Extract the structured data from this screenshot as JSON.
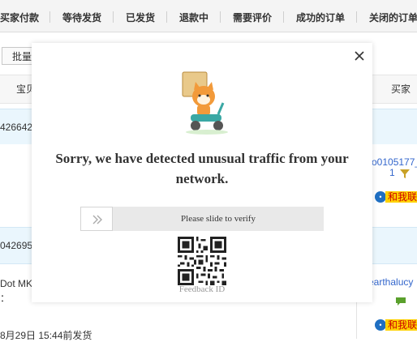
{
  "tabs": [
    "买家付款",
    "等待发货",
    "已发货",
    "退款中",
    "需要评价",
    "成功的订单",
    "关闭的订单"
  ],
  "toolbar": {
    "batch_label": "批量"
  },
  "table_header": {
    "product_label": "宝贝",
    "buyer_label": "买家"
  },
  "orders": [
    {
      "id_fragment": "426642",
      "buyer_line1": "o0105177_",
      "buyer_line2": "1",
      "contact_label": "和我联"
    },
    {
      "id_fragment": "042695",
      "product_fragment": "Dot MK 2",
      "product_fragment2": "：",
      "ship_note": "8月29日 15:44前发货",
      "buyer_name": "earthalucy",
      "contact_label": "和我联"
    }
  ],
  "captcha": {
    "title": "Sorry, we have detected unusual traffic from your network.",
    "slider_text": "Please slide to verify",
    "slider_arrow": "»",
    "feedback_label": "Feedback ID"
  },
  "colors": {
    "order_head_bg": "#eaf6fd",
    "contact_bg": "#ffd200",
    "link": "#3366cc"
  }
}
